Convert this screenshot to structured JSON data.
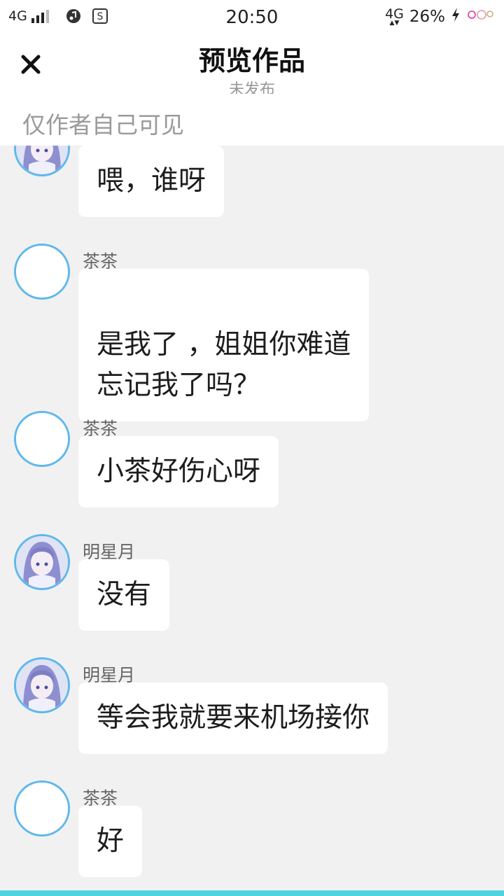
{
  "status_bar": {
    "network_left": "4G",
    "time": "20:50",
    "network_right": "4G",
    "battery": "26%"
  },
  "header": {
    "title": "预览作品",
    "subtitle": "未发布",
    "visibility_note": "仅作者自己可见"
  },
  "messages": [
    {
      "sender": "",
      "text": "喂，谁呀",
      "avatar": "anime-girl-avatar"
    },
    {
      "sender": "茶茶",
      "text": "是我了 ，姐姐你难道\n忘记我了吗？",
      "avatar": "blank-avatar"
    },
    {
      "sender": "茶茶",
      "text": "小茶好伤心呀",
      "avatar": "blank-avatar"
    },
    {
      "sender": "明星月",
      "text": "没有",
      "avatar": "anime-girl-avatar"
    },
    {
      "sender": "明星月",
      "text": "等会我就要来机场接你",
      "avatar": "anime-girl-avatar"
    },
    {
      "sender": "茶茶",
      "text": "好",
      "avatar": "blank-avatar"
    }
  ],
  "colors": {
    "avatar_ring": "#5fb8ec",
    "bottom_bar": "#4fd3de",
    "background": "#f1f1f1"
  }
}
